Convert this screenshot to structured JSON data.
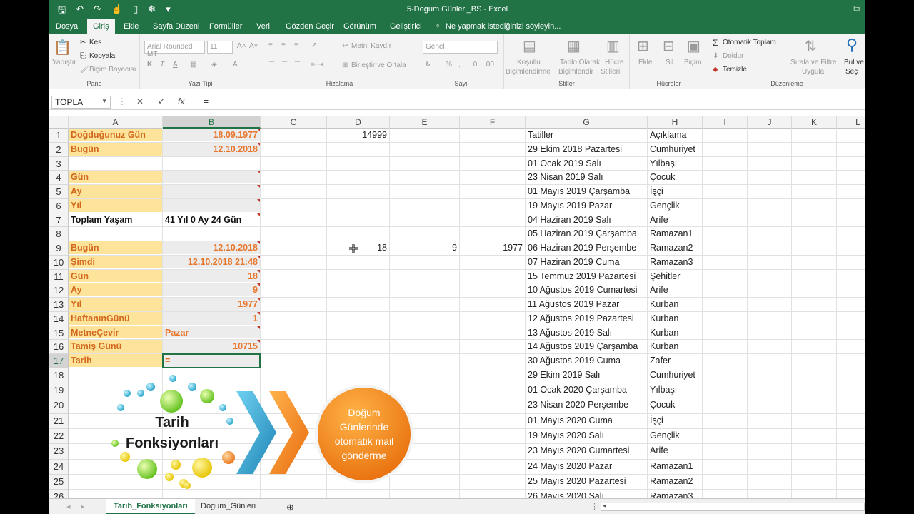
{
  "title": "5-Dogum Günleri_BS - Excel",
  "tabs": [
    "Dosya",
    "Giriş",
    "Ekle",
    "Sayfa Düzeni",
    "Formüller",
    "Veri",
    "Gözden Geçir",
    "Görünüm",
    "Geliştirici"
  ],
  "tell_me": "Ne yapmak istediğinizi söyleyin...",
  "ribbon": {
    "clipboard": {
      "paste": "Yapıştır",
      "cut": "Kes",
      "copy": "Kopyala",
      "format_painter": "Biçim Boyacısı",
      "label": "Pano"
    },
    "font": {
      "name": "Arial Rounded MT",
      "size": "11",
      "label": "Yazı Tipi"
    },
    "alignment": {
      "wrap": "Metni Kaydır",
      "merge": "Birleştir ve Ortala",
      "label": "Hizalama"
    },
    "number": {
      "format": "Genel",
      "label": "Sayı"
    },
    "styles": {
      "conditional_1": "Koşullu",
      "conditional_2": "Biçimlendirme",
      "table_1": "Tablo Olarak",
      "table_2": "Biçimlendir",
      "cell_1": "Hücre",
      "cell_2": "Stilleri",
      "label": "Stiller"
    },
    "cells": {
      "insert": "Ekle",
      "delete": "Sil",
      "format": "Biçim",
      "label": "Hücreler"
    },
    "editing": {
      "autosum": "Otomatik Toplam",
      "fill": "Doldur",
      "clear": "Temizle",
      "sort_1": "Sırala ve Filtre",
      "sort_2": "Uygula",
      "find_1": "Bul ve",
      "find_2": "Seç",
      "label": "Düzenleme"
    }
  },
  "formula_bar": {
    "name_box": "TOPLA",
    "formula": "="
  },
  "columns": [
    "A",
    "B",
    "C",
    "D",
    "E",
    "F",
    "G",
    "H",
    "I",
    "J",
    "K",
    "L"
  ],
  "rows": [
    "1",
    "2",
    "3",
    "4",
    "5",
    "6",
    "7",
    "8",
    "9",
    "10",
    "11",
    "12",
    "13",
    "14",
    "15",
    "16",
    "17",
    "18",
    "19",
    "20",
    "21",
    "22",
    "23",
    "24",
    "25",
    "26"
  ],
  "cells": {
    "A1": "Doğduğunuz Gün",
    "B1": "18.09.1977",
    "D1": "14999",
    "A2": "Bugün",
    "B2": "12.10.2018",
    "A4": "Gün",
    "A5": "Ay",
    "A6": "Yıl",
    "A7": "Toplam Yaşam",
    "B7": "41 Yıl 0 Ay 24 Gün",
    "A9": "Bugün",
    "B9": "12.10.2018",
    "D9": "18",
    "E9": "9",
    "F9": "1977",
    "A10": "Şimdi",
    "B10": "12.10.2018 21:48",
    "A11": "Gün",
    "B11": "18",
    "A12": "Ay",
    "B12": "9",
    "A13": "Yıl",
    "B13": "1977",
    "A14": "HaftanınGünü",
    "B14": "1",
    "A15": "MetneÇevir",
    "B15": "Pazar",
    "A16": "Tamiş Günü",
    "B16": "10715",
    "A17": "Tarih",
    "B17": "="
  },
  "holidays": [
    [
      "Tatiller",
      "Açıklama"
    ],
    [
      "29 Ekim 2018 Pazartesi",
      "Cumhuriyet"
    ],
    [
      "01 Ocak 2019 Salı",
      "Yılbaşı"
    ],
    [
      "23 Nisan 2019 Salı",
      "Çocuk"
    ],
    [
      "01 Mayıs 2019 Çarşamba",
      "İşçi"
    ],
    [
      "19 Mayıs 2019 Pazar",
      "Gençlik"
    ],
    [
      "04 Haziran 2019 Salı",
      "Arife"
    ],
    [
      "05 Haziran 2019 Çarşamba",
      "Ramazan1"
    ],
    [
      "06 Haziran 2019 Perşembe",
      "Ramazan2"
    ],
    [
      "07 Haziran 2019 Cuma",
      "Ramazan3"
    ],
    [
      "15 Temmuz 2019 Pazartesi",
      "Şehitler"
    ],
    [
      "10 Ağustos 2019 Cumartesi",
      "Arife"
    ],
    [
      "11 Ağustos 2019 Pazar",
      "Kurban"
    ],
    [
      "12 Ağustos 2019 Pazartesi",
      "Kurban"
    ],
    [
      "13 Ağustos 2019 Salı",
      "Kurban"
    ],
    [
      "14 Ağustos 2019 Çarşamba",
      "Kurban"
    ],
    [
      "30 Ağustos 2019 Cuma",
      "Zafer"
    ],
    [
      "29 Ekim 2019 Salı",
      "Cumhuriyet"
    ],
    [
      "01 Ocak 2020 Çarşamba",
      "Yılbaşı"
    ],
    [
      "23 Nisan 2020 Perşembe",
      "Çocuk"
    ],
    [
      "01 Mayıs 2020 Cuma",
      "İşçi"
    ],
    [
      "19 Mayıs 2020 Salı",
      "Gençlik"
    ],
    [
      "23 Mayıs 2020 Cumartesi",
      "Arife"
    ],
    [
      "24 Mayıs 2020 Pazar",
      "Ramazan1"
    ],
    [
      "25 Mayıs 2020 Pazartesi",
      "Ramazan2"
    ],
    [
      "26 Mayıs 2020 Salı",
      "Ramazan3"
    ]
  ],
  "overlay": {
    "left_line1": "Tarih",
    "left_line2": "Fonksiyonları",
    "right_line1": "Doğum",
    "right_line2": "Günlerinde",
    "right_line3": "otomatik mail",
    "right_line4": "gönderme"
  },
  "sheets": [
    "Tarih_Fonksiyonları",
    "Dogum_Günleri"
  ],
  "colors": {
    "excel_green": "#217346",
    "label_yellow": "#fde49a",
    "value_orange": "#e8762a",
    "circle_orange": "#f28c1e"
  }
}
